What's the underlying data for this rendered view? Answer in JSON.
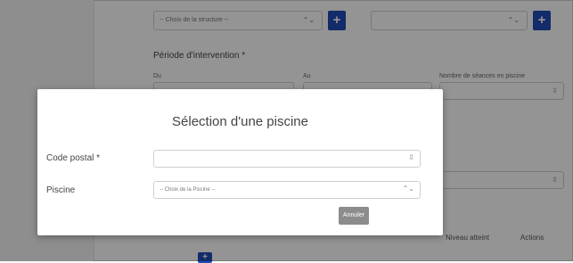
{
  "background": {
    "structure_select": {
      "value": "-- Choix de la structure --",
      "arrow": "⌃⌄"
    },
    "second_select": {
      "value": "",
      "arrow": "⌃⌄"
    },
    "plus_label": "+",
    "period_label": "Période d'intervention *",
    "du_label": "Du",
    "au_label": "Au",
    "seances_label": "Nombre de séances en piscine",
    "table_headers": [
      "Niveau atteint",
      "Actions"
    ]
  },
  "modal": {
    "title": "Sélection d'une piscine",
    "postal_code": {
      "label": "Code postal *",
      "value": "",
      "icon": "⇳"
    },
    "piscine": {
      "label": "Piscine",
      "value": "-- Choix de la Piscine --",
      "arrow": "⌃⌄"
    },
    "cancel_label": "Annuler"
  },
  "colors": {
    "accent": "#1f4bb5",
    "overlay": "#000000",
    "cancel": "#8c8c8c"
  }
}
